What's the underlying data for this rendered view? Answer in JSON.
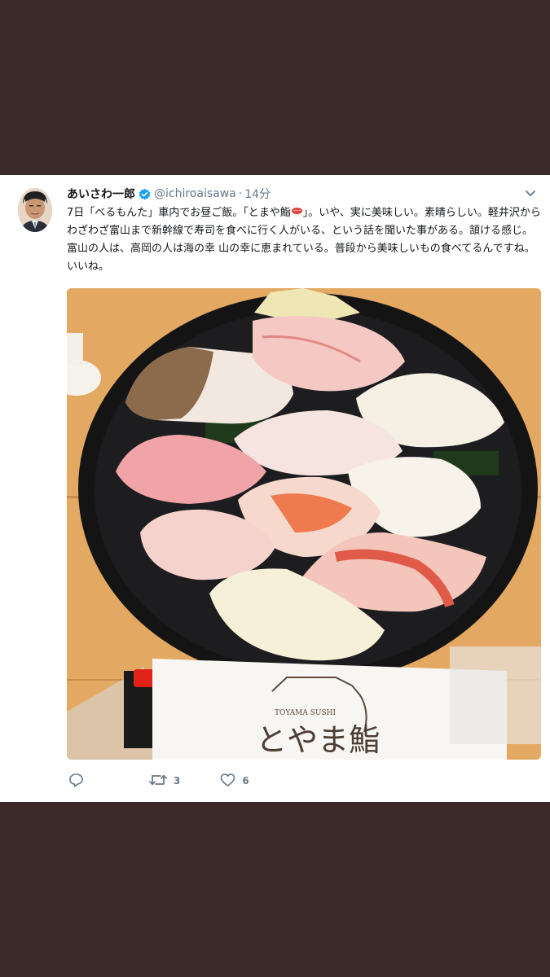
{
  "tweet": {
    "author_name": "あいさわ一郎",
    "handle": "@ichiroaisawa",
    "separator": "·",
    "time": "14分",
    "text_segments": [
      "7日「べるもんた」車内でお昼ご飯。「とまや鮨",
      "」。いや、実に美味しい。素晴らしい。軽井沢からわざわざ富山まで新幹線で寿司を食べに行く人がいる、という話を聞いた事がある。頷ける感じ。富山の人は、高岡の人は海の幸 山の幸に恵まれている。普段から美味しいもの食べてるんですね。いいね。"
    ],
    "emoji_icon": "sushi-emoji-icon",
    "verified_icon": "verified-badge-icon",
    "photo": {
      "package_brand": "TOYAMA SUSHI",
      "package_title": "とやま鮨"
    },
    "actions": {
      "reply_count": "",
      "retweet_count": "3",
      "like_count": "6"
    }
  },
  "colors": {
    "background": "#3b2a29",
    "card": "#ffffff",
    "verified": "#1da1f2",
    "muted_text": "#657786",
    "text": "#14171a"
  }
}
